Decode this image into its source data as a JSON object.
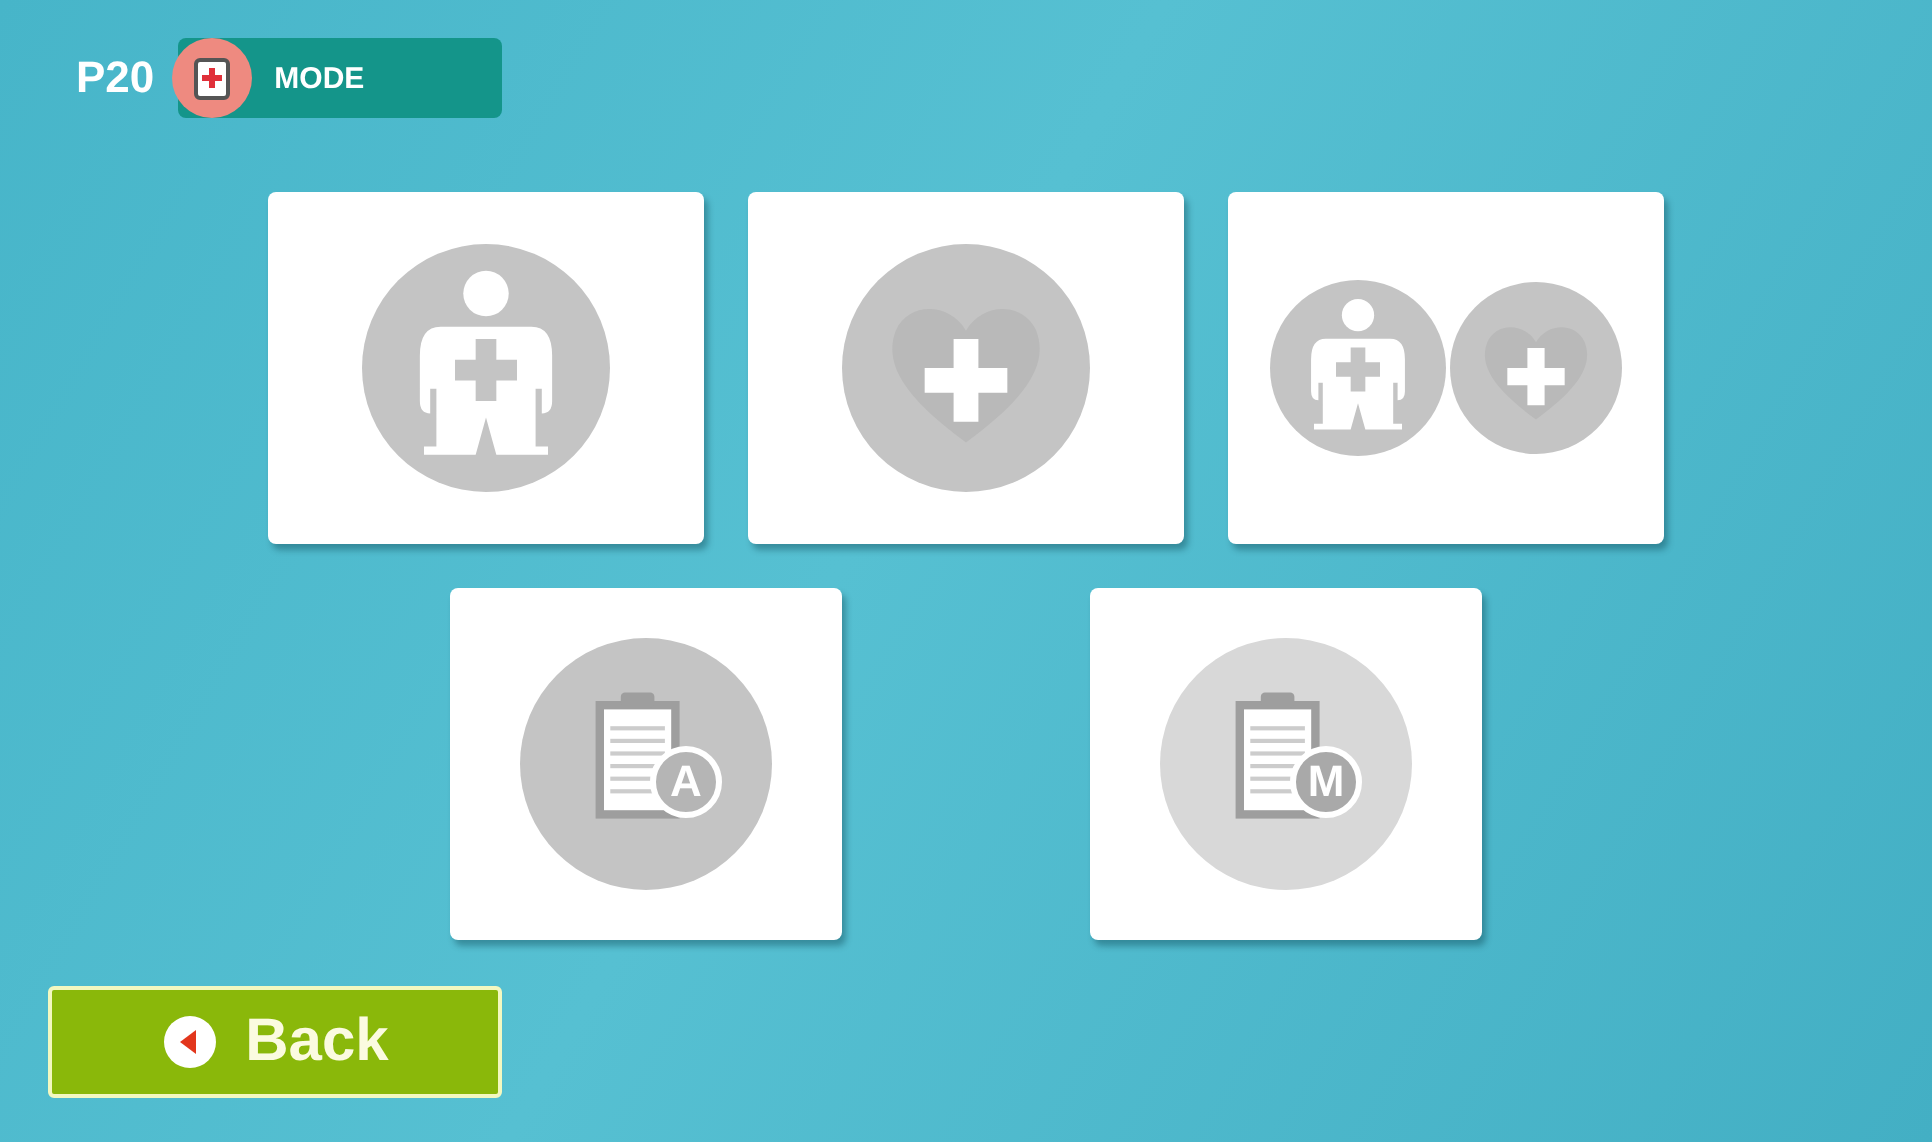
{
  "header": {
    "page": "P20",
    "mode_label": "MODE"
  },
  "tile_rows": [
    [
      {
        "kind": "body",
        "disabled": false
      },
      {
        "kind": "heart",
        "disabled": false
      },
      {
        "kind": "combo",
        "disabled": false
      }
    ],
    [
      {
        "kind": "clipboard",
        "letter": "A",
        "disabled": false
      },
      {
        "kind": "clipboard",
        "letter": "M",
        "disabled": true
      }
    ]
  ],
  "back_button": {
    "label": "Back"
  }
}
